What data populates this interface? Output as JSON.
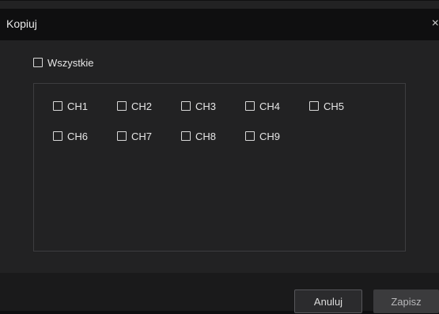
{
  "dialog": {
    "title": "Kopiuj",
    "close_symbol": "×"
  },
  "select_all": {
    "label": "Wszystkie",
    "checked": false
  },
  "channels": [
    {
      "label": "CH1",
      "checked": false
    },
    {
      "label": "CH2",
      "checked": false
    },
    {
      "label": "CH3",
      "checked": false
    },
    {
      "label": "CH4",
      "checked": false
    },
    {
      "label": "CH5",
      "checked": false
    },
    {
      "label": "CH6",
      "checked": false
    },
    {
      "label": "CH7",
      "checked": false
    },
    {
      "label": "CH8",
      "checked": false
    },
    {
      "label": "CH9",
      "checked": false
    }
  ],
  "footer": {
    "cancel_label": "Anuluj",
    "save_label": "Zapisz"
  }
}
